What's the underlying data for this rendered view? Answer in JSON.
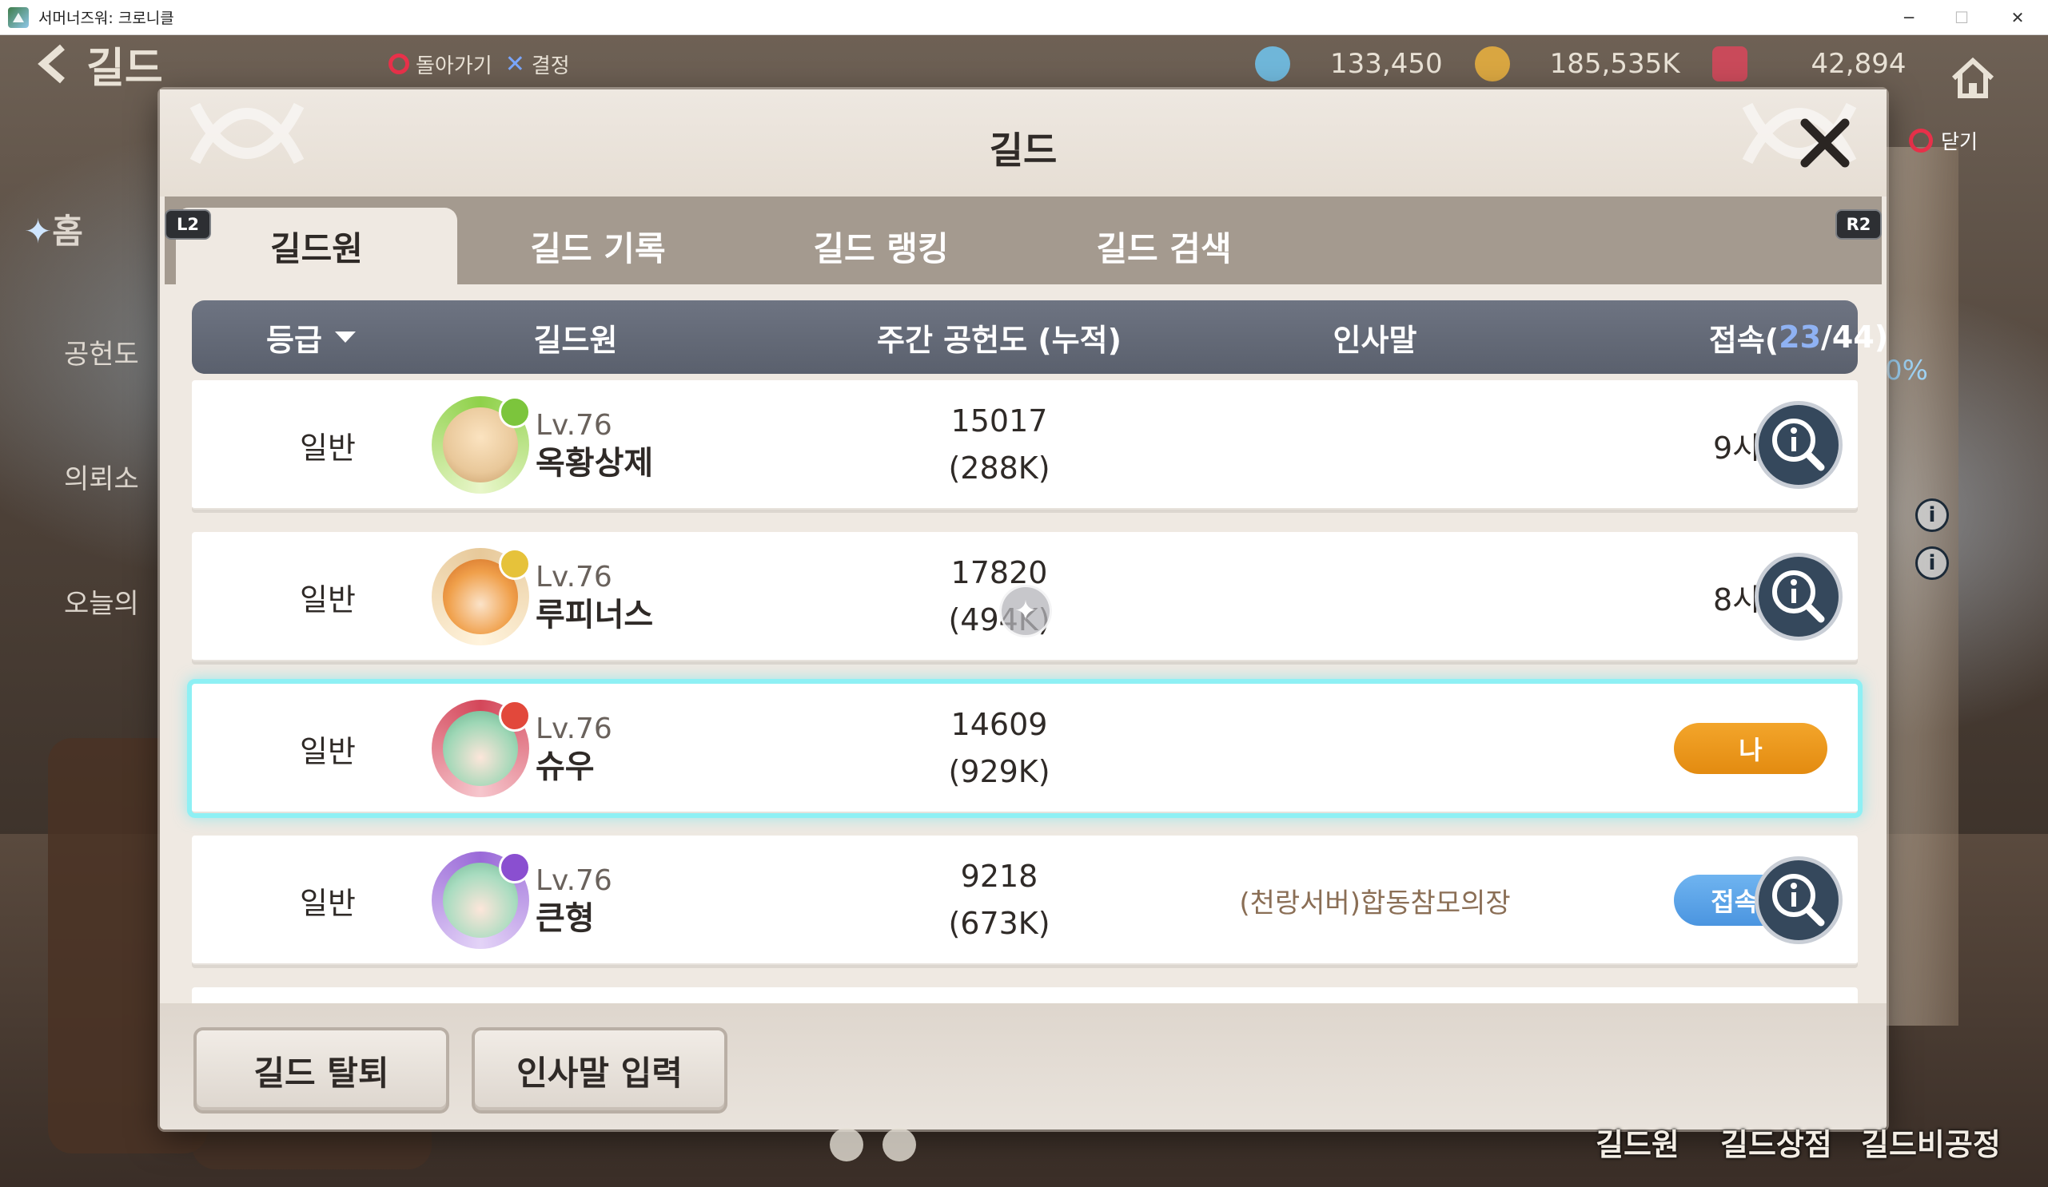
{
  "window": {
    "title": "서머너즈워: 크로니클",
    "icon": "app-icon",
    "controls": [
      "─",
      "☐",
      "✕"
    ]
  },
  "background": {
    "back_label": "길드",
    "back_icon": "back-arrow-icon",
    "prompt_back": "돌아가기",
    "prompt_confirm": "결정",
    "menu": [
      "홈",
      "공헌도",
      "의뢰소",
      "오늘의"
    ],
    "percent": "0%",
    "currencies": [
      {
        "icon": "crystal-icon",
        "value": "133,450",
        "color": "#6fb6d9"
      },
      {
        "icon": "gold-icon",
        "value": "185,535K",
        "color": "#d9a641"
      },
      {
        "icon": "ticket-icon",
        "value": "42,894",
        "color": "#c94a5a"
      }
    ],
    "home_icon": "home-icon",
    "close_hint": "닫기",
    "footer_nav": [
      "길드원",
      "길드상점",
      "길드비공정"
    ]
  },
  "dialog": {
    "title": "길드",
    "close_icon": "close-icon",
    "shoulder_left": "L2",
    "shoulder_right": "R2",
    "tabs": [
      {
        "label": "길드원",
        "active": true
      },
      {
        "label": "길드 기록",
        "active": false
      },
      {
        "label": "길드 랭킹",
        "active": false
      },
      {
        "label": "길드 검색",
        "active": false
      }
    ],
    "table": {
      "headers": {
        "grade": "등급",
        "member": "길드원",
        "contribution": "주간 공헌도 (누적)",
        "greeting": "인사말",
        "access_prefix": "접속(",
        "access_online": "23",
        "access_suffix": "/44)"
      },
      "rows": [
        {
          "grade": "일반",
          "level": "Lv.76",
          "name": "옥황상제",
          "weekly": "15017",
          "total": "(288K)",
          "greeting": "",
          "access": "9시간",
          "status": "time",
          "badge_color": "#7cc53c",
          "ring_color": "#8fd14a",
          "face_color": "#e9c89a"
        },
        {
          "grade": "일반",
          "level": "Lv.76",
          "name": "루피너스",
          "weekly": "17820",
          "total": "(494K)",
          "greeting": "",
          "access": "8시간",
          "status": "time",
          "badge_color": "#e6c23a",
          "ring_color": "#e7c99a",
          "face_color": "#f0a04b"
        },
        {
          "grade": "일반",
          "level": "Lv.76",
          "name": "슈우",
          "weekly": "14609",
          "total": "(929K)",
          "greeting": "",
          "access": "나",
          "status": "me",
          "badge_color": "#e2483b",
          "ring_color": "#d4475a",
          "face_color": "#9fd7b6"
        },
        {
          "grade": "일반",
          "level": "Lv.76",
          "name": "큰형",
          "weekly": "9218",
          "total": "(673K)",
          "greeting": "(천랑서버)합동참모의장",
          "access": "접속 중",
          "status": "online",
          "badge_color": "#8a4fd0",
          "ring_color": "#9a6ad8",
          "face_color": "#a9dcc0"
        }
      ]
    },
    "buttons": {
      "leave": "길드 탈퇴",
      "greeting_input": "인사말 입력"
    }
  }
}
